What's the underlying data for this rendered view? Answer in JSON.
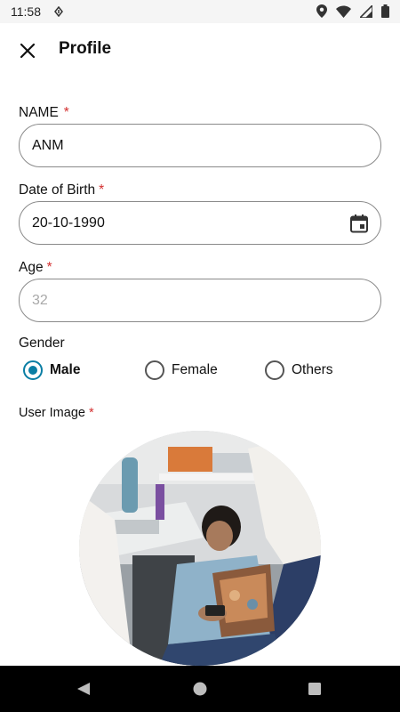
{
  "status_bar": {
    "time": "11:58",
    "icons": [
      "nfc-icon",
      "location-icon",
      "wifi-icon",
      "signal-icon",
      "battery-icon"
    ]
  },
  "app_bar": {
    "title": "Profile",
    "close_icon": "close-icon"
  },
  "form": {
    "name": {
      "label": "NAME",
      "required_mark": "*",
      "value": "ANM"
    },
    "dob": {
      "label": "Date of Birth",
      "required_mark": "*",
      "value": "20-10-1990",
      "icon": "calendar-icon"
    },
    "age": {
      "label": "Age",
      "required_mark": "*",
      "placeholder": "32"
    },
    "gender": {
      "label": "Gender",
      "options": [
        {
          "label": "Male",
          "selected": true
        },
        {
          "label": "Female",
          "selected": false
        },
        {
          "label": "Others",
          "selected": false
        }
      ]
    },
    "user_image": {
      "label": "User Image",
      "required_mark": "*"
    }
  },
  "nav_bar": {
    "buttons": [
      "back-icon",
      "home-icon",
      "recents-icon"
    ]
  },
  "colors": {
    "accent": "#0a7ea4",
    "required": "#d32f2f",
    "border": "#8a8a8a",
    "nav_bg": "#000000"
  }
}
